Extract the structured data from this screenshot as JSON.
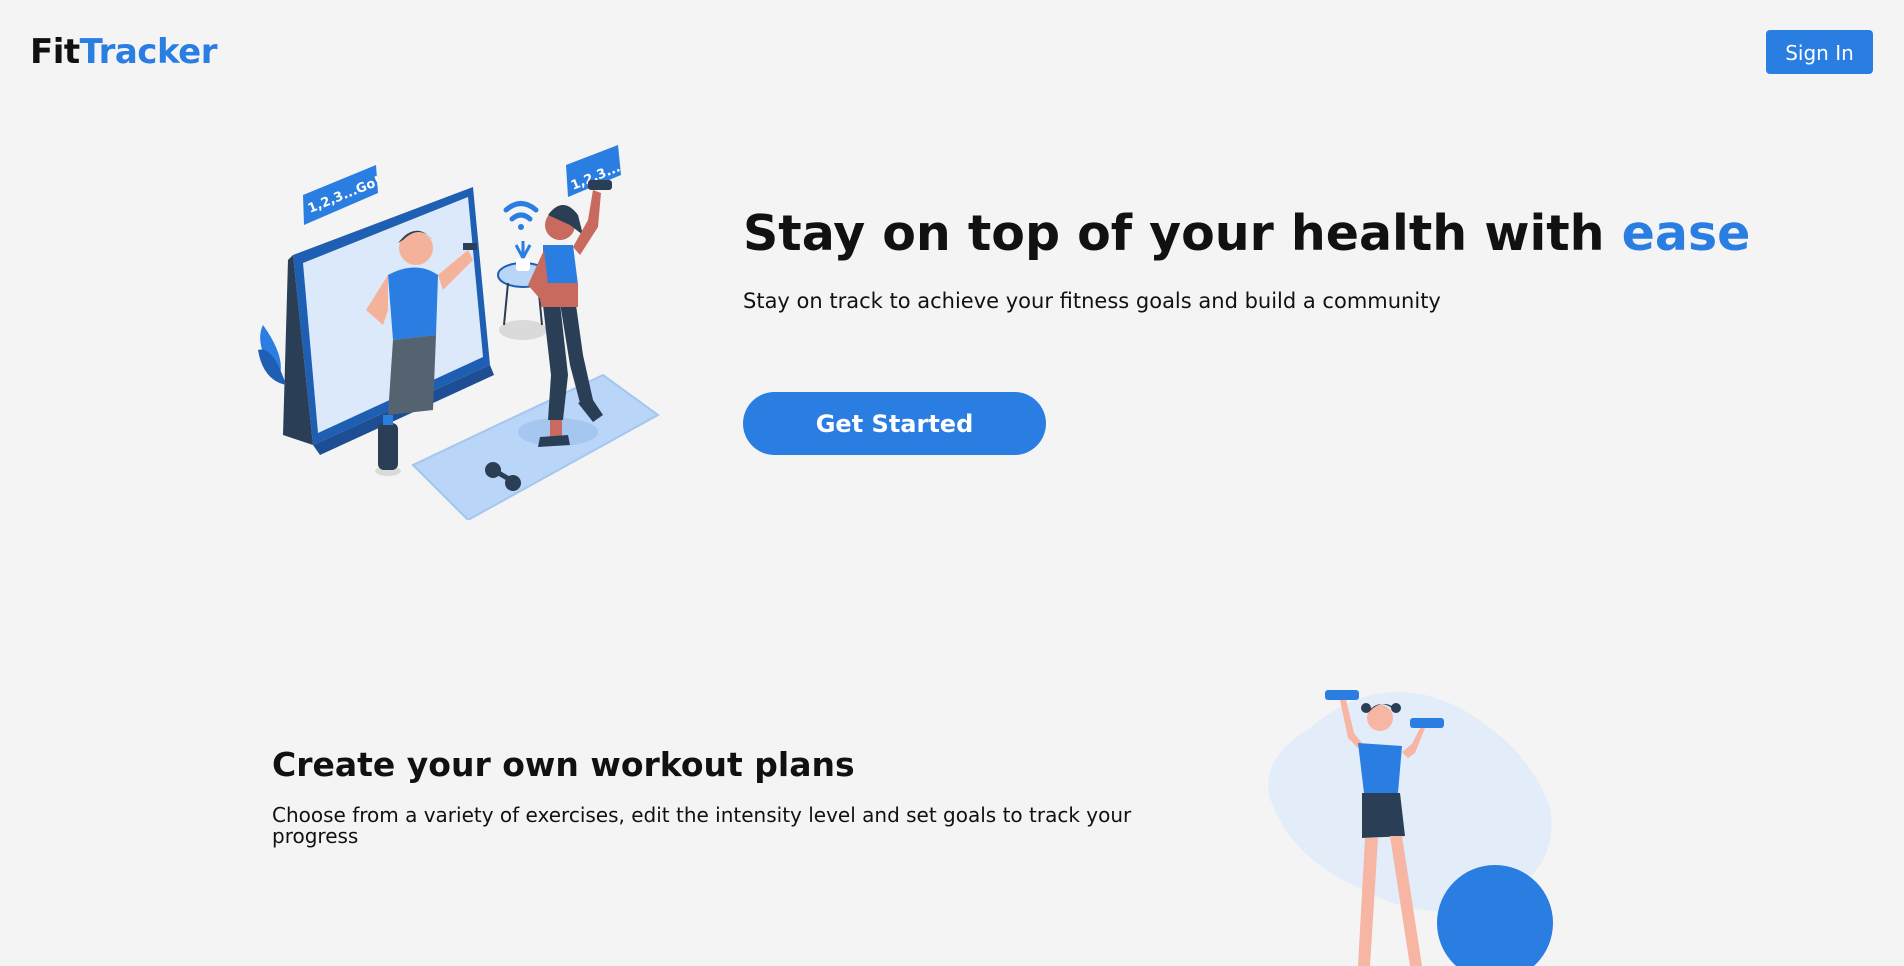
{
  "header": {
    "logo_part1": "Fit",
    "logo_part2": "Tracker",
    "signin_label": "Sign In"
  },
  "hero": {
    "title_main": "Stay on top of your health with ",
    "title_accent": "ease",
    "subtitle": "Stay on track to achieve your fitness goals and build a community",
    "cta_label": "Get Started",
    "bubble_left": "1,2,3...Go!",
    "bubble_right": "1,2,3..."
  },
  "feature": {
    "title": "Create your own workout plans",
    "description": "Choose from a variety of exercises, edit the intensity level and set goals to track your progress"
  },
  "colors": {
    "accent": "#2a7de1",
    "background": "#f4f4f4",
    "text": "#111111"
  }
}
